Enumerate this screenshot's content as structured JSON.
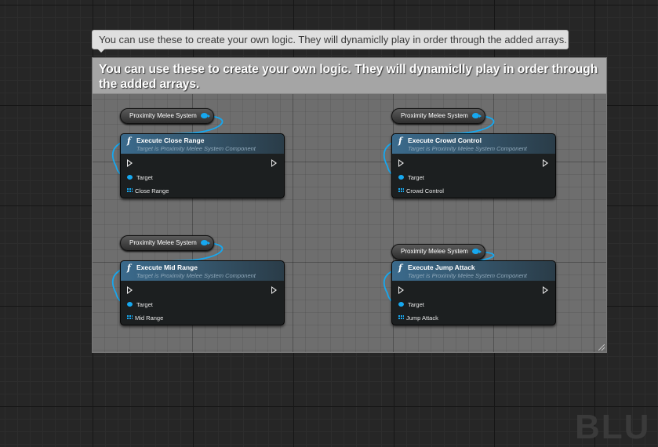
{
  "tooltip": {
    "text": "You can use these to create your own logic. They will dynamiclly play in order through the added arrays."
  },
  "comment": {
    "title": "You can use these to create your own logic. They will dynamiclly play in order through the added arrays."
  },
  "nodes": [
    {
      "variable_label": "Proximity Melee System",
      "function_title": "Execute Close Range",
      "function_subtitle": "Target is Proximity Melee System Component",
      "target_label": "Target",
      "array_label": "Close Range"
    },
    {
      "variable_label": "Proximity Melee System",
      "function_title": "Execute Crowd Control",
      "function_subtitle": "Target is Proximity Melee System Component",
      "target_label": "Target",
      "array_label": "Crowd Control"
    },
    {
      "variable_label": "Proximity Melee System",
      "function_title": "Execute Mid Range",
      "function_subtitle": "Target is Proximity Melee System Component",
      "target_label": "Target",
      "array_label": "Mid Range"
    },
    {
      "variable_label": "Proximity Melee System",
      "function_title": "Execute Jump Attack",
      "function_subtitle": "Target is Proximity Melee System Component",
      "target_label": "Target",
      "array_label": "Jump Attack"
    }
  ],
  "watermark": {
    "text": "BLU"
  },
  "colors": {
    "pin_object": "#16a8f0",
    "wire": "#16a8f0",
    "function_header": "#3a6a8c",
    "comment_header": "#a5a5a5",
    "comment_body": "#6e6e6e"
  },
  "icons": {
    "function": "function-icon",
    "exec": "exec-pin-icon",
    "object_pin": "object-pin-icon",
    "array_pin": "array-pin-icon"
  }
}
